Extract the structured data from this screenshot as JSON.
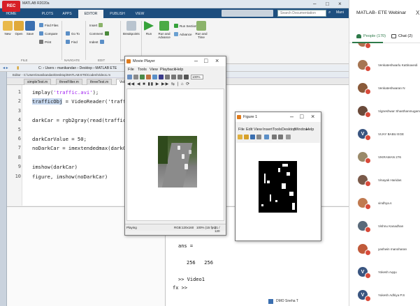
{
  "recorder": {
    "badge": "REC"
  },
  "matlab": {
    "window_title": "MATLAB R2020a",
    "tabs": [
      "HOME",
      "PLOTS",
      "APPS",
      "EDITOR",
      "PUBLISH",
      "VIEW"
    ],
    "active_tab": "EDITOR",
    "search_placeholder": "Search Documentation",
    "user_label": "Mani",
    "ribbon": {
      "file": {
        "new": "New",
        "open": "Open",
        "save": "Save",
        "find_files": "Find Files",
        "compare": "Compare",
        "print": "Print",
        "group": "FILE"
      },
      "navigate": {
        "goto": "Go To",
        "find": "Find",
        "group": "NAVIGATE"
      },
      "edit": {
        "insert": "Insert",
        "comment": "Comment",
        "indent": "Indent",
        "group": "EDIT"
      },
      "breakpoints": {
        "label": "Breakpoints",
        "group": "BREAKPOINTS"
      },
      "run": {
        "run": "Run",
        "run_advance": "Run and Advance",
        "run_section": "Run Section",
        "advance": "Advance",
        "run_time": "Run and Time",
        "group": "RUN"
      }
    },
    "path": "C: › Users › manikandan › Desktop › MATLAB ETE",
    "editor_title": "Editor - C:\\Users\\manikandan\\Desktop\\MATLAB ETE\\Codes\\Video1.m",
    "file_tabs": [
      "simpleTest.m",
      "threeFilter.m",
      "threeTest.m",
      "Video1.m"
    ],
    "active_file": "Video1.m",
    "code_lines": [
      {
        "n": "1",
        "pre": "implay(",
        "str": "'traffic.avi'",
        "post": ");"
      },
      {
        "n": "2",
        "pre": "trafficObj",
        "str": "",
        "post": " = VideoReader('traffic.avi');"
      },
      {
        "n": "3",
        "pre": "",
        "str": "",
        "post": ""
      },
      {
        "n": "4",
        "pre": "darkCar = rgb2gray(read(trafficObj,71));",
        "str": "",
        "post": ""
      },
      {
        "n": "5",
        "pre": "",
        "str": "",
        "post": ""
      },
      {
        "n": "6",
        "pre": "darkCarValue = 50;",
        "str": "",
        "post": ""
      },
      {
        "n": "7",
        "pre": "noDarkCar = imextendedmax(darkCar, darkCarValue);",
        "str": "",
        "post": ""
      },
      {
        "n": "8",
        "pre": "",
        "str": "",
        "post": ""
      },
      {
        "n": "9",
        "pre": "imshow(darkCar)",
        "str": "",
        "post": ""
      },
      {
        "n": "10",
        "pre": "figure, imshow(noDarkCar)",
        "str": "",
        "post": ""
      }
    ],
    "command_window": {
      "ans_label": "ans =",
      "ans_values": "256   256",
      "history": ">> Video1",
      "prompt": "fx >>"
    },
    "taskbar_hint": "DMO Sneha T"
  },
  "movie_player": {
    "title": "Movie Player",
    "menu": [
      "File",
      "Tools",
      "View",
      "Playback",
      "Help"
    ],
    "zoom": "100%",
    "status_left": "Playing",
    "status_mid": "RGB:120x160",
    "status_fps": "100% (15 fps)",
    "status_frame": "21 / 120"
  },
  "figure1": {
    "title": "Figure 1",
    "menu": [
      "File",
      "Edit",
      "View",
      "Insert",
      "Tools",
      "Desktop",
      "Window",
      "Help"
    ]
  },
  "webinar": {
    "title": "MATLAB- ETE Webinar",
    "close": "X",
    "tabs": {
      "people": "People (170)",
      "chat": "Chat (2)"
    },
    "people": [
      {
        "name": "",
        "color": "#b07050"
      },
      {
        "name": "Venkateshwarlu Kattinavedi",
        "color": "#a67552"
      },
      {
        "name": "Venkateshwaran N",
        "color": "#8a5a3a"
      },
      {
        "name": "Vigneshwar Shasthanmugam",
        "color": "#6a4a3a"
      },
      {
        "name": "VIJAY BABU EGE",
        "color": "#3a5580",
        "initial": "V"
      },
      {
        "name": "VIKRAMAN 276",
        "color": "#9a8a6a"
      },
      {
        "name": "Vinayak Haridas",
        "color": "#7a5a4a"
      },
      {
        "name": "vindhya.s",
        "color": "#c07a50"
      },
      {
        "name": "Vishnu Kanadhan",
        "color": "#5a6a7a"
      },
      {
        "name": "yashwin manoharan",
        "color": "#c05a3a"
      },
      {
        "name": "Yokesh Aqqu",
        "color": "#3a5580",
        "initial": "V"
      },
      {
        "name": "Yukesh Adhiya P.S",
        "color": "#3a5580",
        "initial": "V"
      }
    ]
  }
}
